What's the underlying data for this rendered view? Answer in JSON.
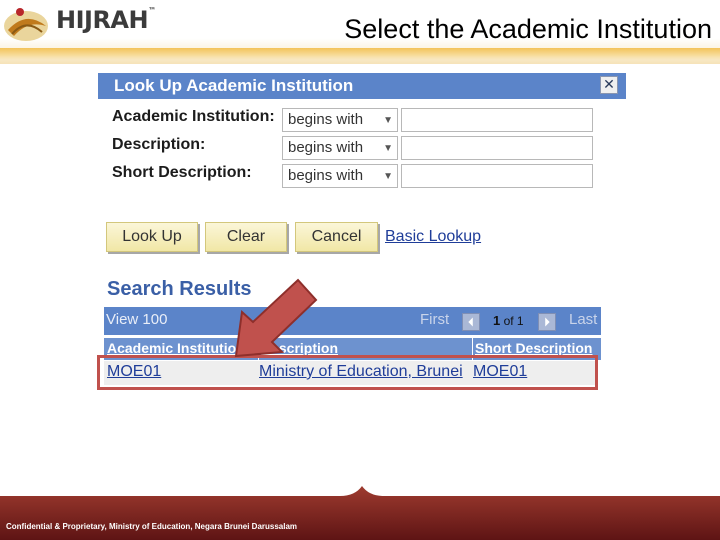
{
  "header": {
    "logo_text": "HIJRAH",
    "logo_trademark": "™",
    "slide_title": "Select the Academic Institution"
  },
  "panel": {
    "title": "Look Up Academic Institution",
    "close_glyph": "✕",
    "fields": [
      {
        "label": "Academic Institution:",
        "operator": "begins with",
        "value": ""
      },
      {
        "label": "Description:",
        "operator": "begins with",
        "value": ""
      },
      {
        "label": "Short Description:",
        "operator": "begins with",
        "value": ""
      }
    ],
    "buttons": {
      "lookup": "Look Up",
      "clear": "Clear",
      "cancel": "Cancel"
    },
    "basic_lookup": "Basic Lookup"
  },
  "results": {
    "heading": "Search Results",
    "view_all": "View 100",
    "first": "First",
    "page_current": "1",
    "page_of": "of 1",
    "last": "Last",
    "columns": [
      "Academic Institution",
      "Description",
      "Short Description"
    ],
    "rows": [
      {
        "institution": "MOE01",
        "description": "Ministry of Education, Brunei",
        "short": "MOE01"
      }
    ]
  },
  "footer": {
    "text": "Confidential & Proprietary, Ministry of Education, Negara Brunei Darussalam"
  },
  "colors": {
    "panel_blue": "#5b84c9",
    "link_blue": "#1f3d99",
    "highlight_red": "#c0514d",
    "footer_brown": "#7a1f1f"
  }
}
